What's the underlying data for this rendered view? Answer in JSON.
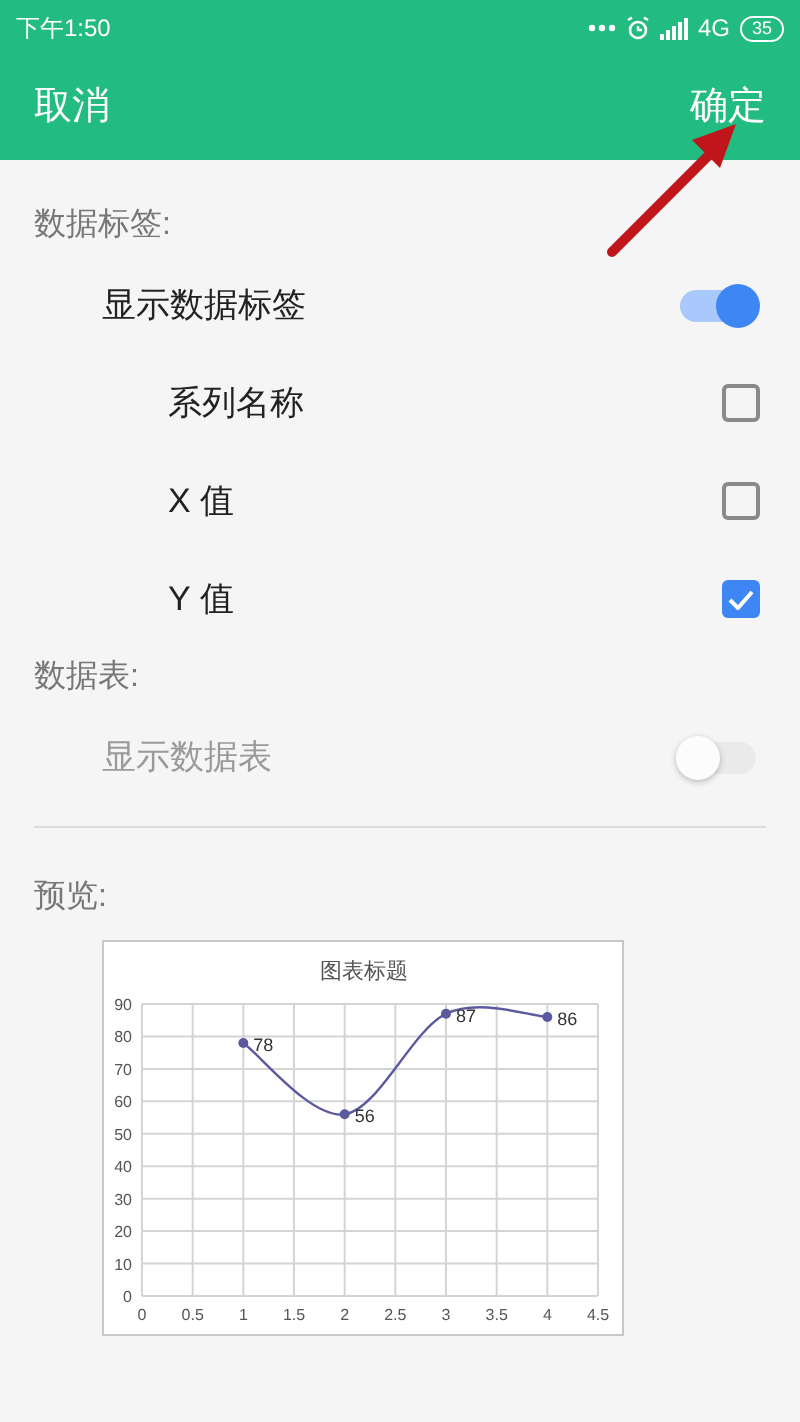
{
  "status_bar": {
    "time": "下午1:50",
    "network": "4G",
    "battery": "35"
  },
  "toolbar": {
    "cancel": "取消",
    "confirm": "确定"
  },
  "sections": [
    {
      "title": "数据标签:",
      "items": [
        {
          "kind": "switch",
          "label": "显示数据标签",
          "on": true,
          "disabled": false,
          "children": [
            {
              "kind": "checkbox",
              "label": "系列名称",
              "checked": false,
              "disabled": false
            },
            {
              "kind": "checkbox",
              "label": "X 值",
              "checked": false,
              "disabled": false
            },
            {
              "kind": "checkbox",
              "label": "Y 值",
              "checked": true,
              "disabled": false
            }
          ]
        }
      ]
    },
    {
      "title": "数据表:",
      "items": [
        {
          "kind": "switch",
          "label": "显示数据表",
          "on": false,
          "disabled": true
        }
      ]
    }
  ],
  "preview": {
    "title": "预览:",
    "chart_data": {
      "type": "line",
      "title": "图表标题",
      "x": [
        1,
        2,
        3,
        4
      ],
      "series": [
        {
          "color": "#5b5a9e",
          "marker": "circle",
          "values": [
            78,
            56,
            87,
            86
          ]
        }
      ],
      "grid": true,
      "xlim": [
        0,
        4.5
      ],
      "ylim": [
        0,
        90
      ],
      "xticks": [
        0,
        0.5,
        1,
        1.5,
        2,
        2.5,
        3,
        3.5,
        4,
        4.5
      ],
      "yticks": [
        0,
        10,
        20,
        30,
        40,
        50,
        60,
        70,
        80,
        90
      ],
      "data_labels": true
    }
  }
}
